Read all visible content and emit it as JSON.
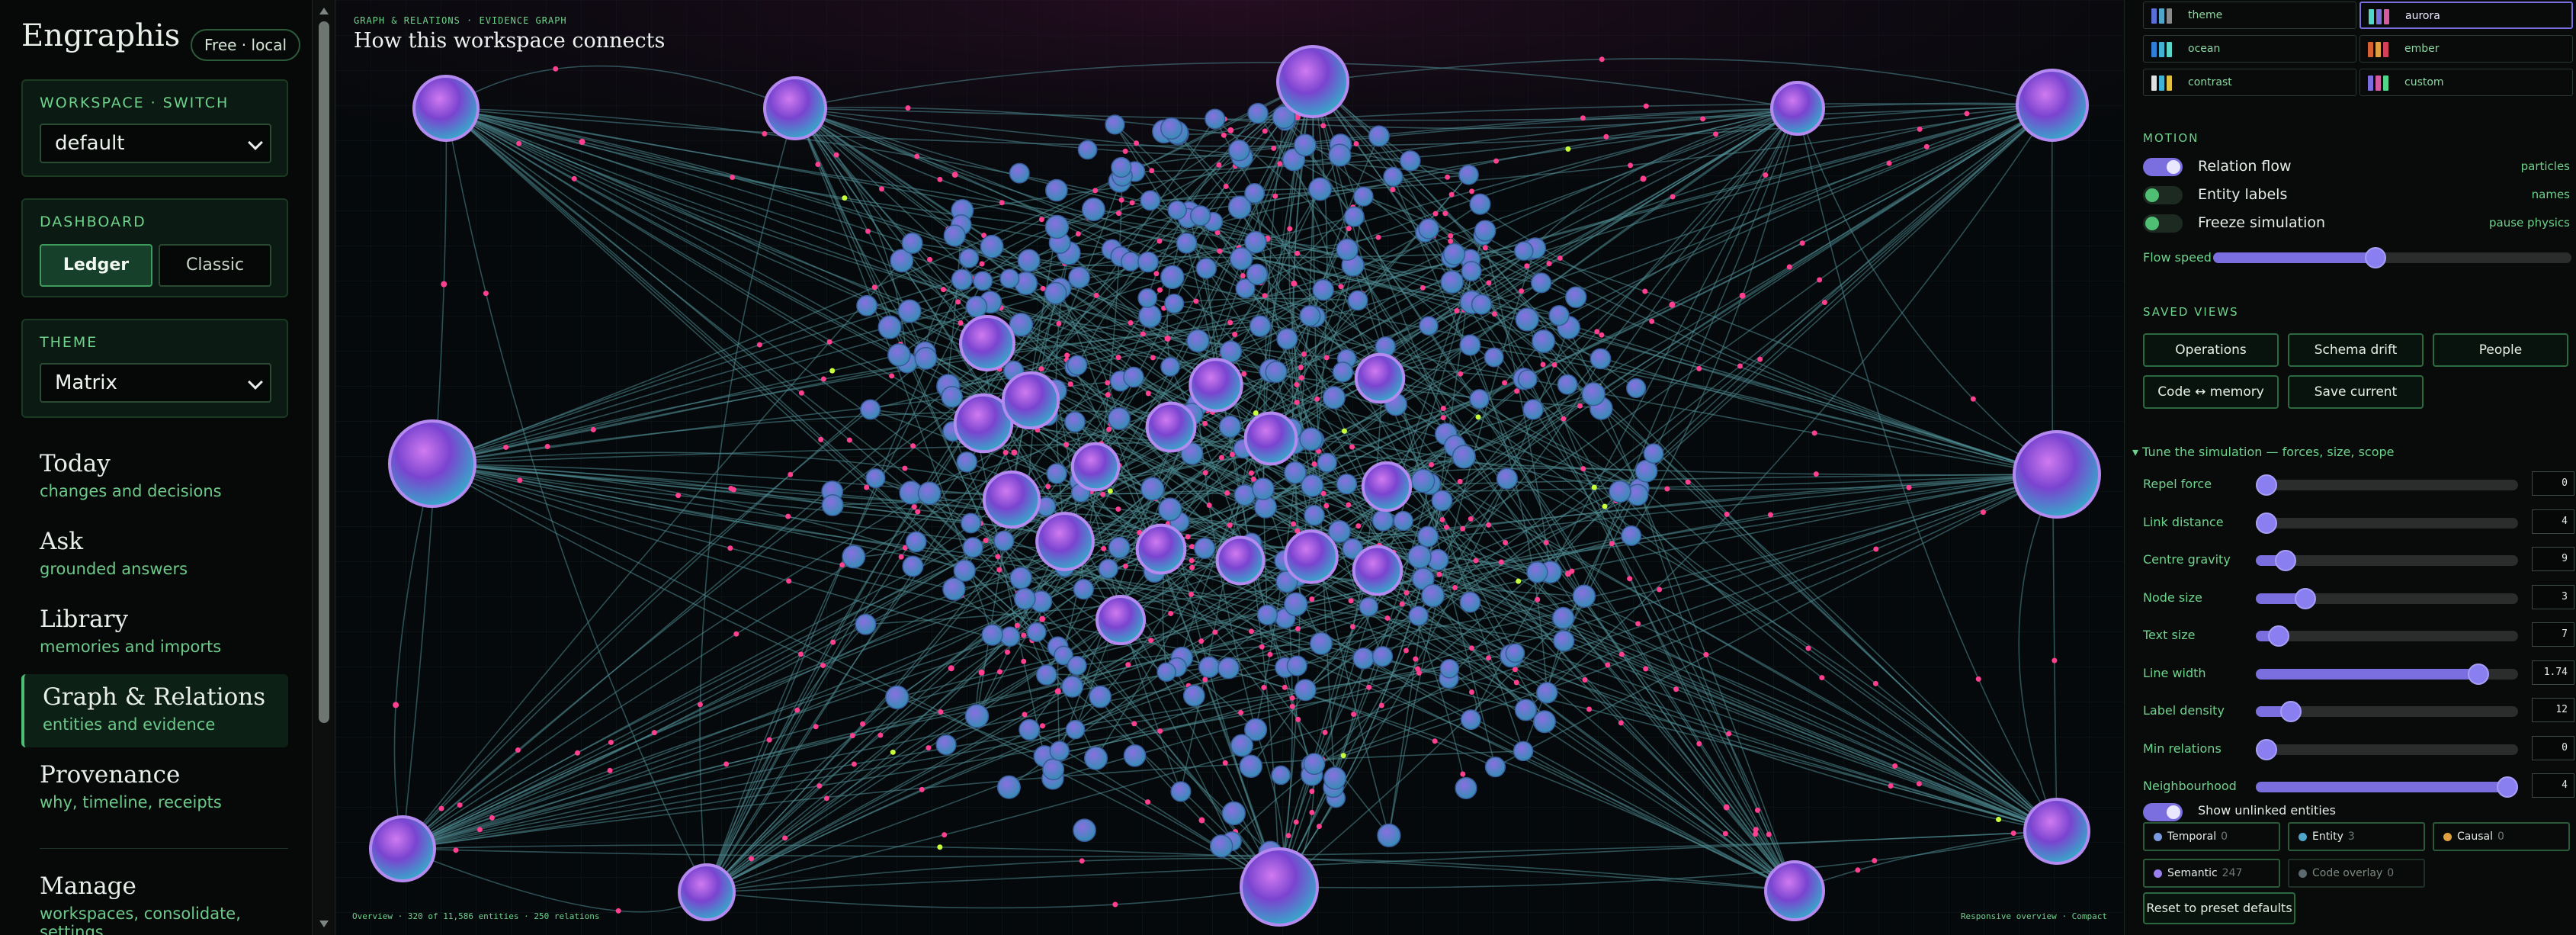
{
  "app": {
    "brand": "Engraphis",
    "plan_badge": "Free · local"
  },
  "workspace": {
    "label": "WORKSPACE · SWITCH",
    "value": "default"
  },
  "dashboard": {
    "label": "DASHBOARD",
    "options": [
      "Ledger",
      "Classic"
    ],
    "selected": "Ledger"
  },
  "theme_select": {
    "label": "THEME",
    "value": "Matrix"
  },
  "nav": [
    {
      "title": "Today",
      "subtitle": "changes and decisions"
    },
    {
      "title": "Ask",
      "subtitle": "grounded answers"
    },
    {
      "title": "Library",
      "subtitle": "memories and imports"
    },
    {
      "title": "Graph & Relations",
      "subtitle": "entities and evidence",
      "active": true
    },
    {
      "title": "Provenance",
      "subtitle": "why, timeline, receipts"
    },
    {
      "title": "Manage",
      "subtitle": "workspaces, consolidate, settings"
    }
  ],
  "graph": {
    "eyebrow": "GRAPH & RELATIONS · EVIDENCE GRAPH",
    "title": "How this workspace connects",
    "footer_left": "Overview · 320 of 11,586 entities · 250 relations",
    "footer_right": "Responsive overview · Compact",
    "colors": {
      "node_a": "#9a3fd6",
      "node_b": "#2fb3c9",
      "edge": "#4f8a92",
      "particle": "#ff3f8f",
      "highlight": "#c9ff3a"
    }
  },
  "palettes": [
    {
      "name": "theme",
      "colors": [
        "#5a6fd6",
        "#4fa6c9",
        "#8a8a8a"
      ],
      "selected": false
    },
    {
      "name": "aurora",
      "colors": [
        "#4fd6c9",
        "#7b6fe0",
        "#d65aa0"
      ],
      "selected": true
    },
    {
      "name": "ocean",
      "colors": [
        "#2f7fd6",
        "#3fb3d6",
        "#5ad6c9"
      ],
      "selected": false
    },
    {
      "name": "ember",
      "colors": [
        "#d6602f",
        "#e0a03f",
        "#d63f5a"
      ],
      "selected": false
    },
    {
      "name": "contrast",
      "colors": [
        "#e0e0e0",
        "#3fb3d6",
        "#e0c03f"
      ],
      "selected": false
    },
    {
      "name": "custom",
      "colors": [
        "#7b6fe0",
        "#d65aa0",
        "#4fd68a"
      ],
      "selected": false
    }
  ],
  "motion": {
    "label": "MOTION",
    "toggles": [
      {
        "label": "Relation flow",
        "hint": "particles",
        "on": true
      },
      {
        "label": "Entity labels",
        "hint": "names",
        "on": false
      },
      {
        "label": "Freeze simulation",
        "hint": "pause physics",
        "on": false
      }
    ],
    "flow_speed": {
      "label": "Flow speed",
      "value": 0.45
    }
  },
  "saved_views": {
    "label": "SAVED VIEWS",
    "buttons": [
      "Operations",
      "Schema drift",
      "People",
      "Code ↔ memory",
      "Save current"
    ]
  },
  "tuning": {
    "header": "▾ Tune the simulation — forces, size, scope",
    "sliders": [
      {
        "label": "Repel force",
        "value": "0",
        "level": 0.0
      },
      {
        "label": "Link distance",
        "value": "4",
        "level": 0.0
      },
      {
        "label": "Centre gravity",
        "value": "9",
        "level": 0.08
      },
      {
        "label": "Node size",
        "value": "3",
        "level": 0.16
      },
      {
        "label": "Text size",
        "value": "7",
        "level": 0.05
      },
      {
        "label": "Line width",
        "value": "1.74",
        "level": 0.88
      },
      {
        "label": "Label density",
        "value": "12",
        "level": 0.1
      },
      {
        "label": "Min relations",
        "value": "0",
        "level": 0.0
      },
      {
        "label": "Neighbourhood",
        "value": "4",
        "level": 1.0
      }
    ],
    "show_unlinked": {
      "label": "Show unlinked entities",
      "on": true
    },
    "relation_types": [
      {
        "label": "Temporal",
        "count": "0",
        "color": "#7b9ae0"
      },
      {
        "label": "Entity",
        "count": "3",
        "color": "#4fa6c9"
      },
      {
        "label": "Causal",
        "count": "0",
        "color": "#e0a03f"
      },
      {
        "label": "Semantic",
        "count": "247",
        "color": "#9a7ff0"
      },
      {
        "label": "Code overlay",
        "count": "0",
        "color": "#5a6a70"
      }
    ],
    "reset_label": "Reset to preset defaults"
  }
}
